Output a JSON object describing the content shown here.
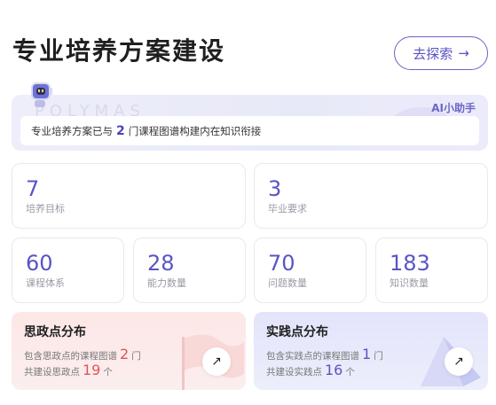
{
  "header": {
    "title": "专业培养方案建设",
    "explore_label": "去探索",
    "explore_icon": "arrow-right-icon"
  },
  "ai_banner": {
    "watermark": "POLYMAS",
    "badge": "AI小助手",
    "message_prefix": "专业培养方案已与",
    "message_count": "2",
    "message_suffix": "门课程图谱构建内在知识衔接"
  },
  "stats": [
    {
      "value": "7",
      "label": "培养目标"
    },
    {
      "value": "3",
      "label": "毕业要求"
    },
    {
      "value": "60",
      "label": "课程体系"
    },
    {
      "value": "28",
      "label": "能力数量"
    },
    {
      "value": "70",
      "label": "问题数量"
    },
    {
      "value": "183",
      "label": "知识数量"
    }
  ],
  "ideology": {
    "title": "思政点分布",
    "line1_prefix": "包含思政点的课程图谱",
    "line1_count": "2",
    "line1_unit": "门",
    "line2_prefix": "共建设思政点",
    "line2_count": "19",
    "line2_unit": "个",
    "icon": "arrow-up-right-icon",
    "accent": "#e05555"
  },
  "practice": {
    "title": "实践点分布",
    "line1_prefix": "包含实践点的课程图谱",
    "line1_count": "1",
    "line1_unit": "门",
    "line2_prefix": "共建设实践点",
    "line2_count": "16",
    "line2_unit": "个",
    "icon": "arrow-up-right-icon",
    "accent": "#5b54c4"
  }
}
